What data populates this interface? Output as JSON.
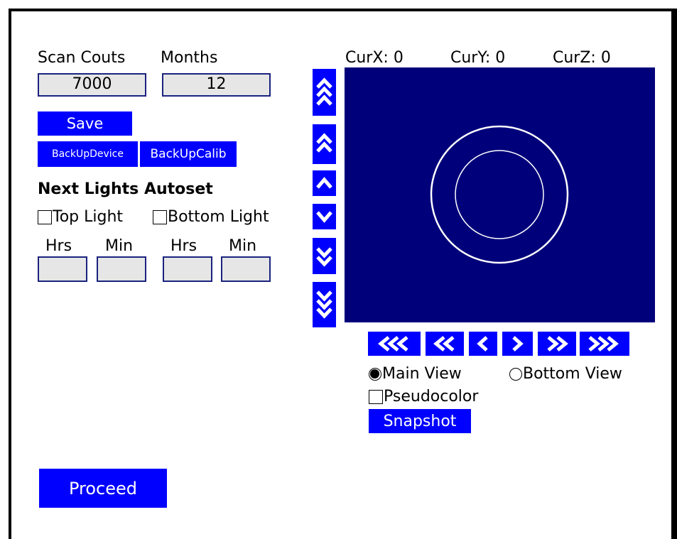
{
  "scan": {
    "counts_label": "Scan Couts",
    "months_label": "Months",
    "counts_value": "7000",
    "months_value": "12"
  },
  "buttons": {
    "save": "Save",
    "backup_device": "BackUpDevice",
    "backup_calib": "BackUpCalib",
    "proceed": "Proceed",
    "snapshot": "Snapshot"
  },
  "autoset": {
    "title": "Next Lights Autoset",
    "top_light": "Top Light",
    "bottom_light": "Bottom Light",
    "top_light_checked": false,
    "bottom_light_checked": false,
    "time_labels": [
      "Hrs",
      "Min",
      "Hrs",
      "Min"
    ],
    "time_values": [
      "",
      "",
      "",
      ""
    ]
  },
  "coords": {
    "x": "CurX: 0",
    "y": "CurY: 0",
    "z": "CurZ: 0"
  },
  "view": {
    "main_view": "Main View",
    "bottom_view": "Bottom View",
    "selected": "Main View",
    "pseudocolor": "Pseudocolor",
    "pseudocolor_checked": false
  },
  "icons": {
    "vertical": [
      "triple-chevron-up-icon",
      "double-chevron-up-icon",
      "chevron-up-icon",
      "chevron-down-icon",
      "double-chevron-down-icon",
      "triple-chevron-down-icon"
    ],
    "horizontal": [
      "triple-chevron-left-icon",
      "double-chevron-left-icon",
      "chevron-left-icon",
      "chevron-right-icon",
      "double-chevron-right-icon",
      "triple-chevron-right-icon"
    ]
  },
  "colors": {
    "button": "#0000ff",
    "viewer_background": "#00007a",
    "field_background": "#e6e6e6",
    "field_border": "#1a237e"
  }
}
